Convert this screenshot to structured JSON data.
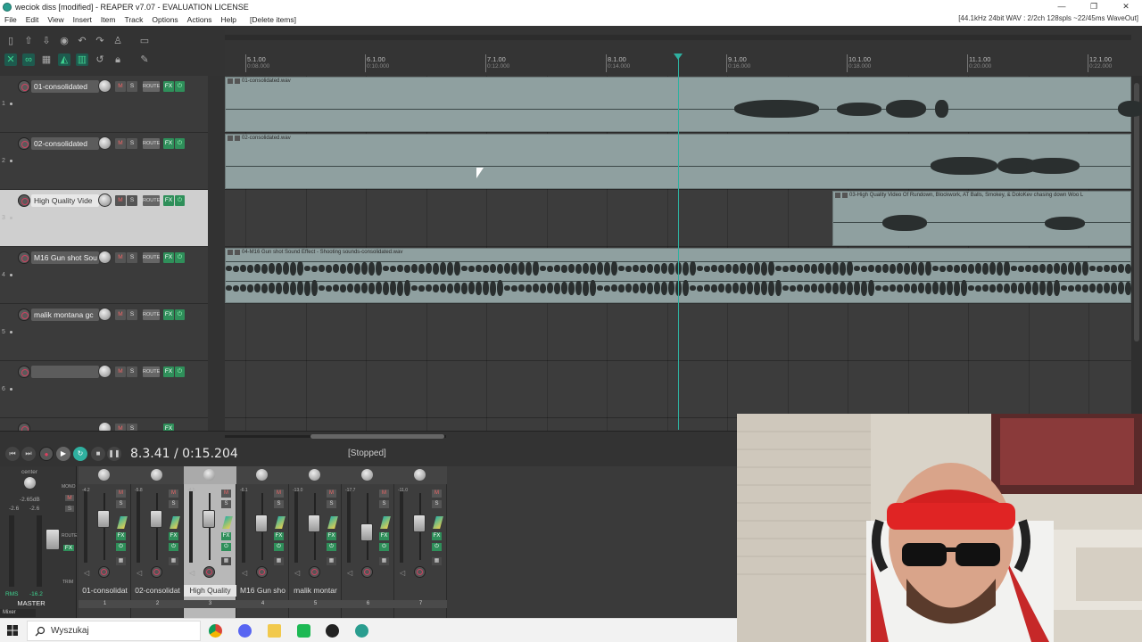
{
  "window": {
    "title": "weciok diss [modified] - REAPER v7.07 - EVALUATION LICENSE",
    "controls": [
      "—",
      "❐",
      "✕"
    ]
  },
  "menu": {
    "items": [
      "File",
      "Edit",
      "View",
      "Insert",
      "Item",
      "Track",
      "Options",
      "Actions",
      "Help"
    ],
    "last_action": "[Delete items]",
    "audio_status": "[44.1kHz 24bit WAV : 2/2ch 128spls ~22/45ms WaveOut]"
  },
  "ruler": {
    "marks": [
      {
        "bar": "5.1.00",
        "time": "0:08.000"
      },
      {
        "bar": "6.1.00",
        "time": "0:10.000"
      },
      {
        "bar": "7.1.00",
        "time": "0:12.000"
      },
      {
        "bar": "8.1.00",
        "time": "0:14.000"
      },
      {
        "bar": "9.1.00",
        "time": "0:16.000"
      },
      {
        "bar": "10.1.00",
        "time": "0:18.000"
      },
      {
        "bar": "11.1.00",
        "time": "0:20.000"
      },
      {
        "bar": "12.1.00",
        "time": "0:22.000"
      }
    ]
  },
  "tracks": [
    {
      "num": "1",
      "name": "01-consolidated",
      "route": "ROUTE",
      "fx": "FX"
    },
    {
      "num": "2",
      "name": "02-consolidated",
      "route": "ROUTE",
      "fx": "FX"
    },
    {
      "num": "3",
      "name": "High Quality Vide",
      "route": "ROUTE",
      "fx": "FX"
    },
    {
      "num": "4",
      "name": "M16 Gun shot Sou",
      "route": "ROUTE",
      "fx": "FX"
    },
    {
      "num": "5",
      "name": "malik montana gc",
      "route": "ROUTE",
      "fx": "FX"
    },
    {
      "num": "6",
      "name": "",
      "route": "ROUTE",
      "fx": "FX"
    }
  ],
  "track_buttons": {
    "mute": "M",
    "solo": "S"
  },
  "items": [
    {
      "label": "01-consolidated.wav"
    },
    {
      "label": "02-consolidated.wav"
    },
    {
      "label": "03-High Quality Video Of Rundown, Blockwork, AT Balls, Smokey, & DoloKev chasing down Woo L"
    },
    {
      "label": "04-M16 Gun shot Sound Effect - Shooting sounds-consolidated.wav"
    }
  ],
  "transport": {
    "position": "8.3.41 / 0:15.204",
    "state": "[Stopped]"
  },
  "mixer": {
    "master": {
      "pan_label": "center",
      "peak": "-2.65dB",
      "left_peak": "-2.6",
      "right_peak": "-2.6",
      "rms": "RMS",
      "rms_value": "-16.2",
      "mono": "MONO",
      "route": "ROUTE",
      "fx": "FX",
      "trim": "TRIM",
      "name": "MASTER"
    },
    "strips": [
      {
        "name": "01-consolidat",
        "num": "1",
        "peak": "-4.2",
        "fader": 0.62
      },
      {
        "name": "02-consolidat",
        "num": "2",
        "peak": "-5.8",
        "fader": 0.62
      },
      {
        "name": "High Quality",
        "num": "3",
        "peak": "-4.5",
        "fader": 0.62
      },
      {
        "name": "M16 Gun sho",
        "num": "4",
        "peak": "-6.1",
        "fader": 0.55
      },
      {
        "name": "malik montar",
        "num": "5",
        "peak": "-13.0",
        "fader": 0.55
      },
      {
        "name": "",
        "num": "6",
        "peak": "-17.7",
        "fader": 0.42
      },
      {
        "name": "",
        "num": "7",
        "peak": "-11.0",
        "fader": 0.55
      }
    ],
    "strip_buttons": {
      "mute": "M",
      "solo": "S",
      "fx": "FX"
    },
    "tab": "Mixer"
  },
  "taskbar": {
    "search_placeholder": "Wyszukaj",
    "apps": [
      "chrome-icon",
      "discord-icon",
      "file-explorer-icon",
      "spotify-icon",
      "media-player-icon",
      "reaper-icon"
    ]
  },
  "colors": {
    "playhead": "#2fb0a0",
    "item": "#8fa0a0",
    "record": "#d04060",
    "fx_green": "#2f8f5a"
  }
}
